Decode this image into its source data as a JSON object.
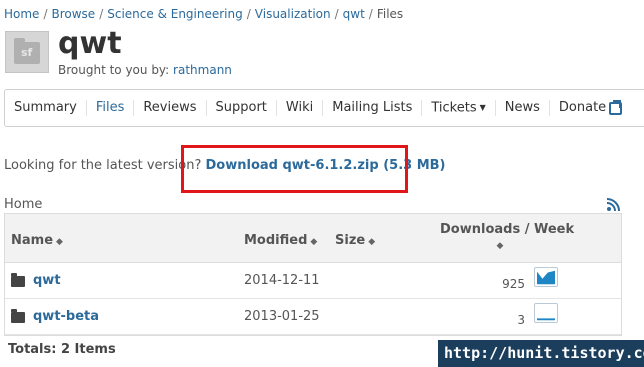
{
  "breadcrumb": {
    "items": [
      "Home",
      "Browse",
      "Science & Engineering",
      "Visualization",
      "qwt"
    ],
    "current": "Files",
    "separator": "/"
  },
  "project": {
    "name": "qwt",
    "brought_prefix": "Brought to you by:",
    "owner": "rathmann",
    "icon_text": "sf"
  },
  "nav": {
    "tabs": [
      "Summary",
      "Files",
      "Reviews",
      "Support",
      "Wiki",
      "Mailing Lists",
      "Tickets",
      "News",
      "Donate"
    ],
    "active": "Files"
  },
  "latest": {
    "prompt": "Looking for the latest version?",
    "link": "Download qwt-6.1.2.zip (5.3 MB)"
  },
  "files": {
    "location": "Home",
    "columns": {
      "name": "Name",
      "modified": "Modified",
      "size": "Size",
      "downloads": "Downloads / Week",
      "sort_symbol": "◆"
    },
    "rows": [
      {
        "name": "qwt",
        "modified": "2014-12-11",
        "size": "",
        "downloads": "925"
      },
      {
        "name": "qwt-beta",
        "modified": "2013-01-25",
        "size": "",
        "downloads": "3"
      }
    ],
    "totals": "Totals: 2 Items"
  },
  "watermark": "http://hunit.tistory.com",
  "colors": {
    "link": "#2b6a9b",
    "highlight": "#e0161a",
    "watermark_bg": "#1b3e5c",
    "spark_fill": "#1f86c5"
  }
}
